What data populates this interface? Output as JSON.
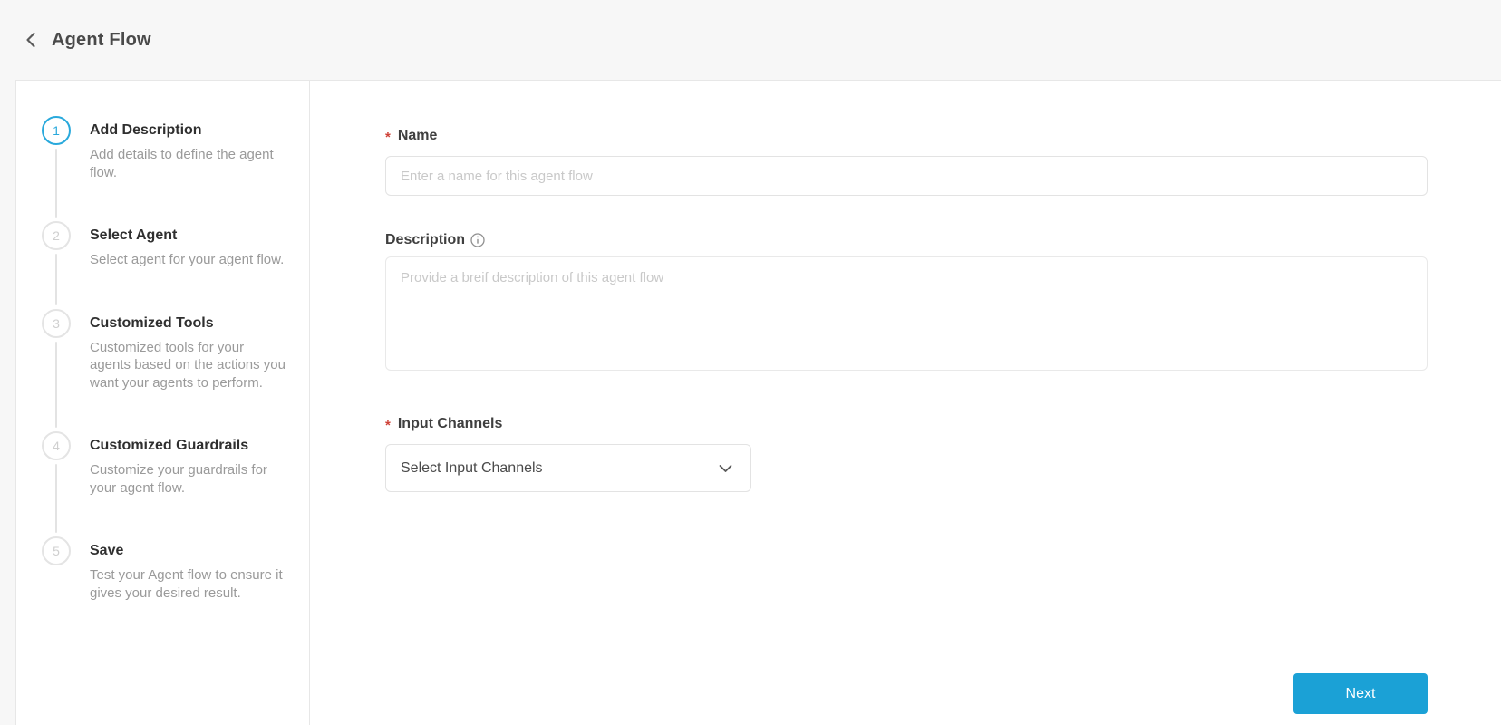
{
  "header": {
    "title": "Agent Flow"
  },
  "stepper": {
    "steps": [
      {
        "number": "1",
        "title": "Add Description",
        "description": "Add details to define the agent flow."
      },
      {
        "number": "2",
        "title": "Select Agent",
        "description": "Select agent for your agent flow."
      },
      {
        "number": "3",
        "title": "Customized Tools",
        "description": "Customized tools for your agents based on the actions you want your agents to perform."
      },
      {
        "number": "4",
        "title": "Customized Guardrails",
        "description": "Customize your guardrails for your agent flow."
      },
      {
        "number": "5",
        "title": "Save",
        "description": "Test your Agent flow to ensure it gives your desired result."
      }
    ]
  },
  "form": {
    "required_mark": "*",
    "name": {
      "label": "Name",
      "placeholder": "Enter a name for this agent flow",
      "value": ""
    },
    "description": {
      "label": "Description",
      "info_icon": "info",
      "placeholder": "Provide a breif description of this agent flow",
      "value": ""
    },
    "input_channels": {
      "label": "Input Channels",
      "selected": "Select Input Channels"
    },
    "next_label": "Next"
  },
  "colors": {
    "accent": "#29a9dc",
    "button": "#1ba1d6",
    "required": "#cf4137"
  }
}
